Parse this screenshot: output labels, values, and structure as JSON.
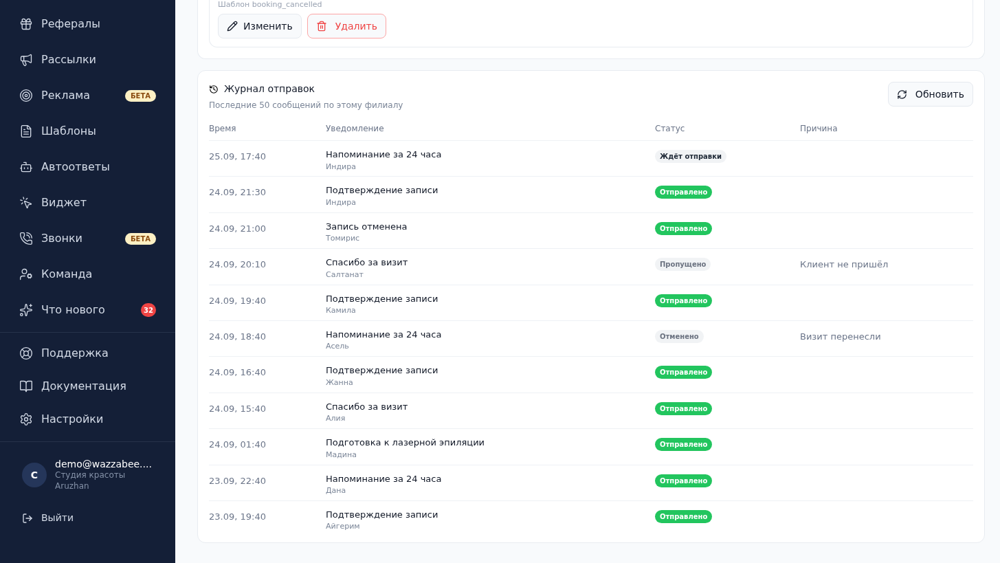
{
  "sidebar": {
    "items": [
      {
        "label": "Рефералы"
      },
      {
        "label": "Рассылки"
      },
      {
        "label": "Реклама",
        "badge": {
          "text": "БЕТА",
          "kind": "beta"
        }
      },
      {
        "label": "Шаблоны"
      },
      {
        "label": "Автоответы"
      },
      {
        "label": "Виджет"
      },
      {
        "label": "Звонки",
        "badge": {
          "text": "БЕТА",
          "kind": "beta"
        }
      },
      {
        "label": "Команда"
      },
      {
        "label": "Что нового",
        "badge": {
          "text": "32",
          "kind": "count"
        }
      }
    ],
    "bottom_items": [
      {
        "label": "Поддержка"
      },
      {
        "label": "Документация"
      },
      {
        "label": "Настройки"
      }
    ],
    "user": {
      "avatar": "C",
      "email": "demo@wazzabee....",
      "company": "Студия красоты",
      "name": "Aruzhan"
    },
    "logout": "Выйти"
  },
  "template_card": {
    "subtitle": "Шаблон booking_cancelled",
    "edit_button": "Изменить",
    "delete_button": "Удалить"
  },
  "log": {
    "title": "Журнал отправок",
    "subtitle": "Последние 50 сообщений по этому филиалу",
    "refresh_button": "Обновить",
    "columns": [
      "Время",
      "Уведомление",
      "Статус",
      "Причина"
    ],
    "rows": [
      {
        "time": "25.09, 17:40",
        "notification": "Напоминание за 24 часа",
        "client": "Индира",
        "status": {
          "text": "Ждёт отправки",
          "kind": "pending"
        }
      },
      {
        "time": "24.09, 21:30",
        "notification": "Подтверждение записи",
        "client": "Индира",
        "status": {
          "text": "Отправлено",
          "kind": "sent"
        }
      },
      {
        "time": "24.09, 21:00",
        "notification": "Запись отменена",
        "client": "Томирис",
        "status": {
          "text": "Отправлено",
          "kind": "sent"
        }
      },
      {
        "time": "24.09, 20:10",
        "notification": "Спасибо за визит",
        "client": "Салтанат",
        "status": {
          "text": "Пропущено",
          "kind": "muted"
        },
        "reason": "Клиент не пришёл"
      },
      {
        "time": "24.09, 19:40",
        "notification": "Подтверждение записи",
        "client": "Камила",
        "status": {
          "text": "Отправлено",
          "kind": "sent"
        }
      },
      {
        "time": "24.09, 18:40",
        "notification": "Напоминание за 24 часа",
        "client": "Асель",
        "status": {
          "text": "Отменено",
          "kind": "muted"
        },
        "reason": "Визит перенесли"
      },
      {
        "time": "24.09, 16:40",
        "notification": "Подтверждение записи",
        "client": "Жанна",
        "status": {
          "text": "Отправлено",
          "kind": "sent"
        }
      },
      {
        "time": "24.09, 15:40",
        "notification": "Спасибо за визит",
        "client": "Алия",
        "status": {
          "text": "Отправлено",
          "kind": "sent"
        }
      },
      {
        "time": "24.09, 01:40",
        "notification": "Подготовка к лазерной эпиляции",
        "client": "Мадина",
        "status": {
          "text": "Отправлено",
          "kind": "sent"
        }
      },
      {
        "time": "23.09, 22:40",
        "notification": "Напоминание за 24 часа",
        "client": "Дана",
        "status": {
          "text": "Отправлено",
          "kind": "sent"
        }
      },
      {
        "time": "23.09, 19:40",
        "notification": "Подтверждение записи",
        "client": "Айгерим",
        "status": {
          "text": "Отправлено",
          "kind": "sent"
        }
      }
    ]
  }
}
